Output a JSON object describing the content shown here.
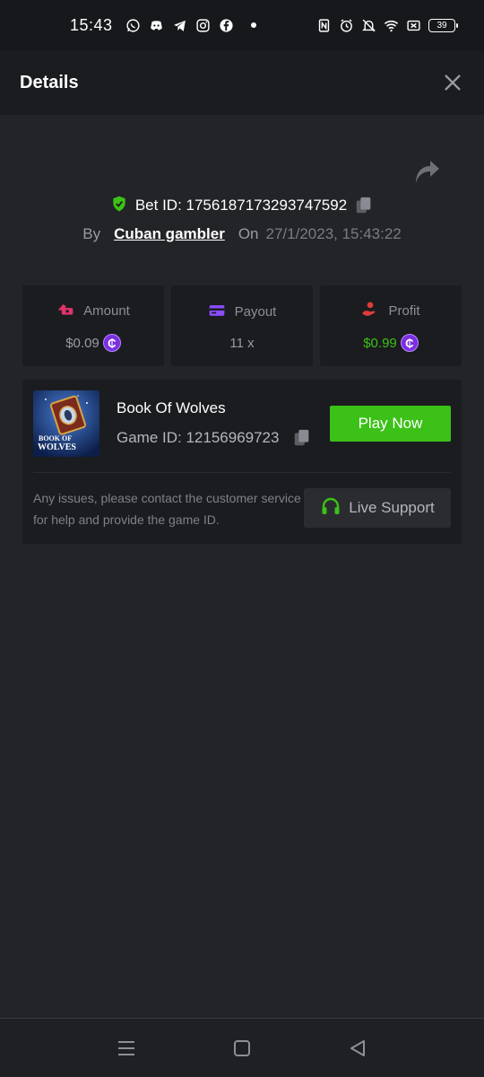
{
  "status_bar": {
    "time": "15:43",
    "battery": "39",
    "left_icons": [
      "whatsapp-icon",
      "discord-icon",
      "telegram-icon",
      "instagram-icon",
      "facebook-icon"
    ],
    "right_icons": [
      "nfc-icon",
      "alarm-icon",
      "mute-icon",
      "wifi-icon",
      "screen-icon"
    ]
  },
  "header": {
    "title": "Details"
  },
  "bet": {
    "id_label": "Bet ID: 1756187173293747592",
    "by_label": "By",
    "user": "Cuban gambler",
    "on_label": "On",
    "date": "27/1/2023, 15:43:22"
  },
  "stats": [
    {
      "label": "Amount",
      "value": "$0.09",
      "icon": "amount-icon",
      "color": "#e0336c"
    },
    {
      "label": "Payout",
      "value": "11 x",
      "icon": "payout-card-icon",
      "color": "#8a4dff"
    },
    {
      "label": "Profit",
      "value": "$0.99",
      "icon": "profit-icon",
      "color": "#e03b3b"
    }
  ],
  "coin_symbol": "₵",
  "game": {
    "name": "Book Of Wolves",
    "id_label": "Game ID: 12156969723",
    "thumb_text": "BOOK OF WOLVES",
    "play_label": "Play Now",
    "help_text": "Any issues, please contact the customer service for help and provide the game ID.",
    "support_label": "Live Support"
  },
  "colors": {
    "accent_green": "#3bc117",
    "background": "#232427",
    "card": "#1b1c1f"
  }
}
